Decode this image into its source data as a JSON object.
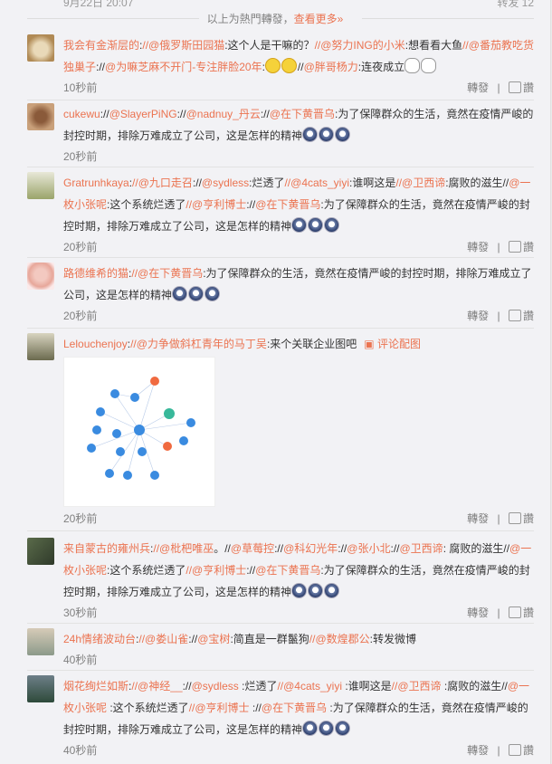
{
  "top_partial": {
    "date": "9月22日 20:07",
    "repost": "转发 12"
  },
  "hot_notice": {
    "text": "以上为熱門轉發，",
    "more": "查看更多»"
  },
  "labels": {
    "repost": "轉發",
    "like": "讚"
  },
  "comments": [
    {
      "name": "我会有金渐层的",
      "segments": [
        {
          "t": ":",
          "k": "plain"
        },
        {
          "t": "//@俄罗斯田园猫",
          "k": "at"
        },
        {
          "t": ":这个人是干嘛的？",
          "k": "plain"
        },
        {
          "t": "//@努力ING的小米",
          "k": "at"
        },
        {
          "t": ":想看看大鱼",
          "k": "plain"
        },
        {
          "t": "//@番茄教吃货独巢子",
          "k": "at"
        },
        {
          "t": "://",
          "k": "plain"
        },
        {
          "t": "@为嘛芝麻不开门-专注胖脸20年",
          "k": "at"
        },
        {
          "t": ":",
          "k": "plain"
        }
      ],
      "tail_segments": [
        {
          "t": "//",
          "k": "plain"
        },
        {
          "t": "@胖哥杨力",
          "k": "at"
        },
        {
          "t": ":连夜成立",
          "k": "plain"
        }
      ],
      "emoji_mid": [
        "smile",
        "smile"
      ],
      "emoji_end": [
        "glass",
        "glass"
      ],
      "time": "10秒前"
    },
    {
      "name": "cukewu",
      "segments": [
        {
          "t": "://",
          "k": "plain"
        },
        {
          "t": "@SlayerPiNG",
          "k": "at"
        },
        {
          "t": "://",
          "k": "plain"
        },
        {
          "t": "@nadnuy_丹云",
          "k": "at"
        },
        {
          "t": "://",
          "k": "plain"
        },
        {
          "t": "@在下黄晋乌",
          "k": "at"
        },
        {
          "t": ":为了保障群众的生活，竟然在疫情严峻的封控时期，排除万难成立了公司，这是怎样的精神",
          "k": "plain"
        }
      ],
      "emoji_end": [
        "face",
        "face",
        "face"
      ],
      "time": "20秒前"
    },
    {
      "name": "Gratrunhkaya",
      "segments": [
        {
          "t": ":",
          "k": "plain"
        },
        {
          "t": "//@九口走召",
          "k": "at"
        },
        {
          "t": "://",
          "k": "plain"
        },
        {
          "t": "@sydless",
          "k": "at"
        },
        {
          "t": ":烂透了",
          "k": "plain"
        },
        {
          "t": "//@4cats_yiyi",
          "k": "at"
        },
        {
          "t": ":谁啊这是",
          "k": "plain"
        },
        {
          "t": "//@卫西谛",
          "k": "at"
        },
        {
          "t": ":腐败的滋生//",
          "k": "plain"
        },
        {
          "t": "@一枚小张呢",
          "k": "at"
        },
        {
          "t": ":这个系统烂透了",
          "k": "plain"
        },
        {
          "t": "//@亨利博士",
          "k": "at"
        },
        {
          "t": "://",
          "k": "plain"
        },
        {
          "t": "@在下黄晋乌",
          "k": "at"
        },
        {
          "t": ":为了保障群众的生活，竟然在疫情严峻的封控时期，排除万难成立了公司，这是怎样的精神",
          "k": "plain"
        }
      ],
      "emoji_end": [
        "face",
        "face",
        "face"
      ],
      "time": "20秒前"
    },
    {
      "name": "路德维希的猫",
      "segments": [
        {
          "t": ":",
          "k": "plain"
        },
        {
          "t": "//@在下黄晋乌",
          "k": "at"
        },
        {
          "t": ":为了保障群众的生活，竟然在疫情严峻的封控时期，排除万难成立了公司，这是怎样的精神",
          "k": "plain"
        }
      ],
      "emoji_end": [
        "face",
        "face",
        "face"
      ],
      "time": "20秒前"
    },
    {
      "name": "Lelouchenjoy",
      "segments": [
        {
          "t": ":",
          "k": "plain"
        },
        {
          "t": "//@力争做斜杠青年的马丁吴",
          "k": "at"
        },
        {
          "t": ":来个关联企业图吧",
          "k": "plain"
        }
      ],
      "pic_label": "评论配图",
      "time": "20秒前"
    },
    {
      "name": "来自蒙古的雍州兵",
      "segments": [
        {
          "t": ":",
          "k": "plain"
        },
        {
          "t": "//@枇杷唯巫",
          "k": "at"
        },
        {
          "t": "。//",
          "k": "plain"
        },
        {
          "t": "@草莓控",
          "k": "at"
        },
        {
          "t": "://",
          "k": "plain"
        },
        {
          "t": "@科幻光年",
          "k": "at"
        },
        {
          "t": "://",
          "k": "plain"
        },
        {
          "t": "@张小北",
          "k": "at"
        },
        {
          "t": "://",
          "k": "plain"
        },
        {
          "t": "@卫西谛",
          "k": "at"
        },
        {
          "t": ": 腐败的滋生//",
          "k": "plain"
        },
        {
          "t": "@一枚小张呢",
          "k": "at"
        },
        {
          "t": ":这个系统烂透了",
          "k": "plain"
        },
        {
          "t": "//@亨利博士",
          "k": "at"
        },
        {
          "t": "://",
          "k": "plain"
        },
        {
          "t": "@在下黄晋乌",
          "k": "at"
        },
        {
          "t": ":为了保障群众的生活，竟然在疫情严峻的封控时期，排除万难成立了公司，这是怎样的精神",
          "k": "plain"
        }
      ],
      "emoji_end": [
        "face",
        "face",
        "face"
      ],
      "time": "30秒前"
    },
    {
      "name": "24h情绪波动台",
      "segments": [
        {
          "t": ":",
          "k": "plain"
        },
        {
          "t": "//@娄山雀",
          "k": "at"
        },
        {
          "t": "://",
          "k": "plain"
        },
        {
          "t": "@宝树",
          "k": "at"
        },
        {
          "t": ":简直是一群鬣狗",
          "k": "plain"
        },
        {
          "t": "//@数煌郡公",
          "k": "at"
        },
        {
          "t": ":转发微博",
          "k": "plain"
        }
      ],
      "time": "40秒前"
    },
    {
      "name": "烟花绚烂如斯",
      "segments": [
        {
          "t": ":",
          "k": "plain"
        },
        {
          "t": "//@神经__",
          "k": "at"
        },
        {
          "t": "://",
          "k": "plain"
        },
        {
          "t": "@sydless",
          "k": "at"
        },
        {
          "t": " :烂透了",
          "k": "plain"
        },
        {
          "t": "//@4cats_yiyi",
          "k": "at"
        },
        {
          "t": " :谁啊这是",
          "k": "plain"
        },
        {
          "t": "//@卫西谛",
          "k": "at"
        },
        {
          "t": " :腐败的滋生//",
          "k": "plain"
        },
        {
          "t": "@一枚小张呢",
          "k": "at"
        },
        {
          "t": " :这个系统烂透了",
          "k": "plain"
        },
        {
          "t": "//@亨利博士",
          "k": "at"
        },
        {
          "t": " ://",
          "k": "plain"
        },
        {
          "t": "@在下黄晋乌",
          "k": "at"
        },
        {
          "t": " :为了保障群众的生活，竟然在疫情严峻的封控时期，排除万难成立了公司，这是怎样的精神",
          "k": "plain"
        }
      ],
      "emoji_end": [
        "face",
        "face",
        "face"
      ],
      "time": "40秒前"
    }
  ]
}
